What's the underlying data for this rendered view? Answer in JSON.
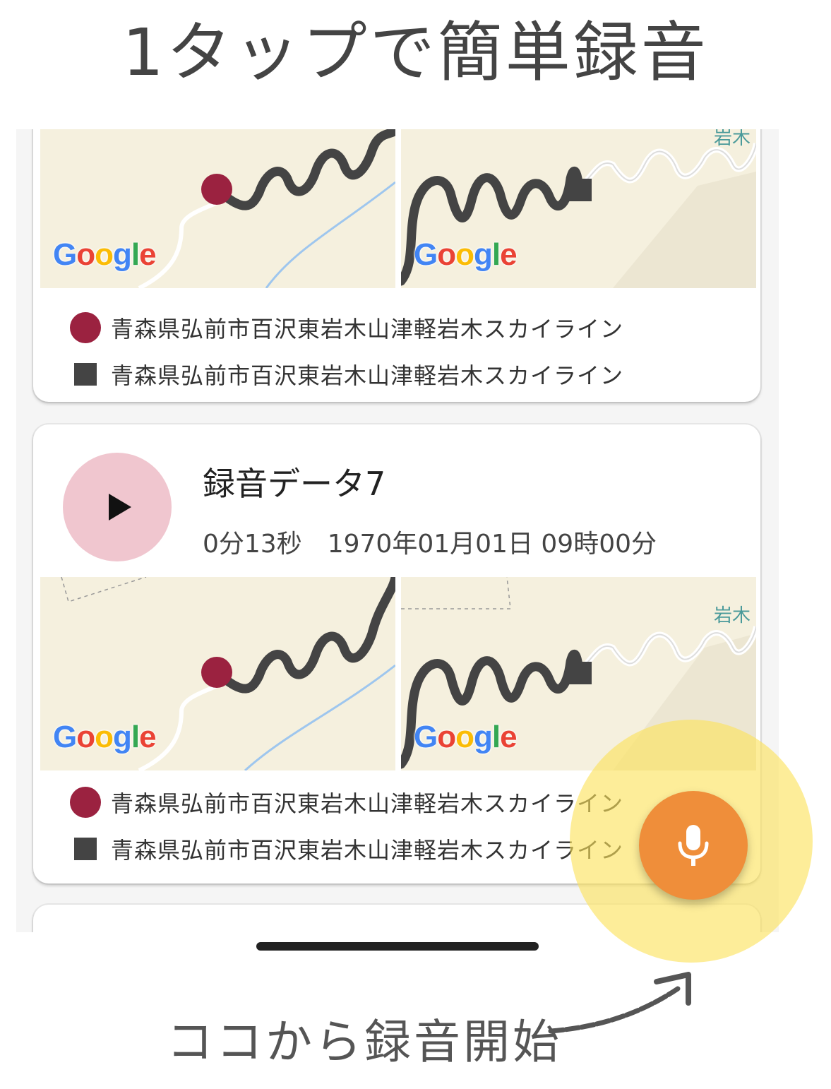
{
  "headline": "1タップで簡単録音",
  "map_logo": {
    "G": "G",
    "o1": "o",
    "o2": "o",
    "g": "g",
    "l": "l",
    "e": "e"
  },
  "card_top": {
    "start_location": "青森県弘前市百沢東岩木山津軽岩木スカイライン",
    "end_location": "青森県弘前市百沢東岩木山津軽岩木スカイライン",
    "map_label": "岩木"
  },
  "card_main": {
    "title": "録音データ7",
    "meta": "0分13秒　1970年01月01日 09時00分",
    "map_label": "岩木",
    "start_location": "青森県弘前市百沢東岩木山津軽岩木スカイライン",
    "end_location": "青森県弘前市百沢東岩木山津軽岩木スカイライン"
  },
  "caption": "ココから録音開始",
  "colors": {
    "start_marker": "#9b2240",
    "end_marker": "#444444",
    "play_button": "#f0c6cf",
    "fab": "#ef8e3a",
    "highlight": "#fce25a"
  }
}
